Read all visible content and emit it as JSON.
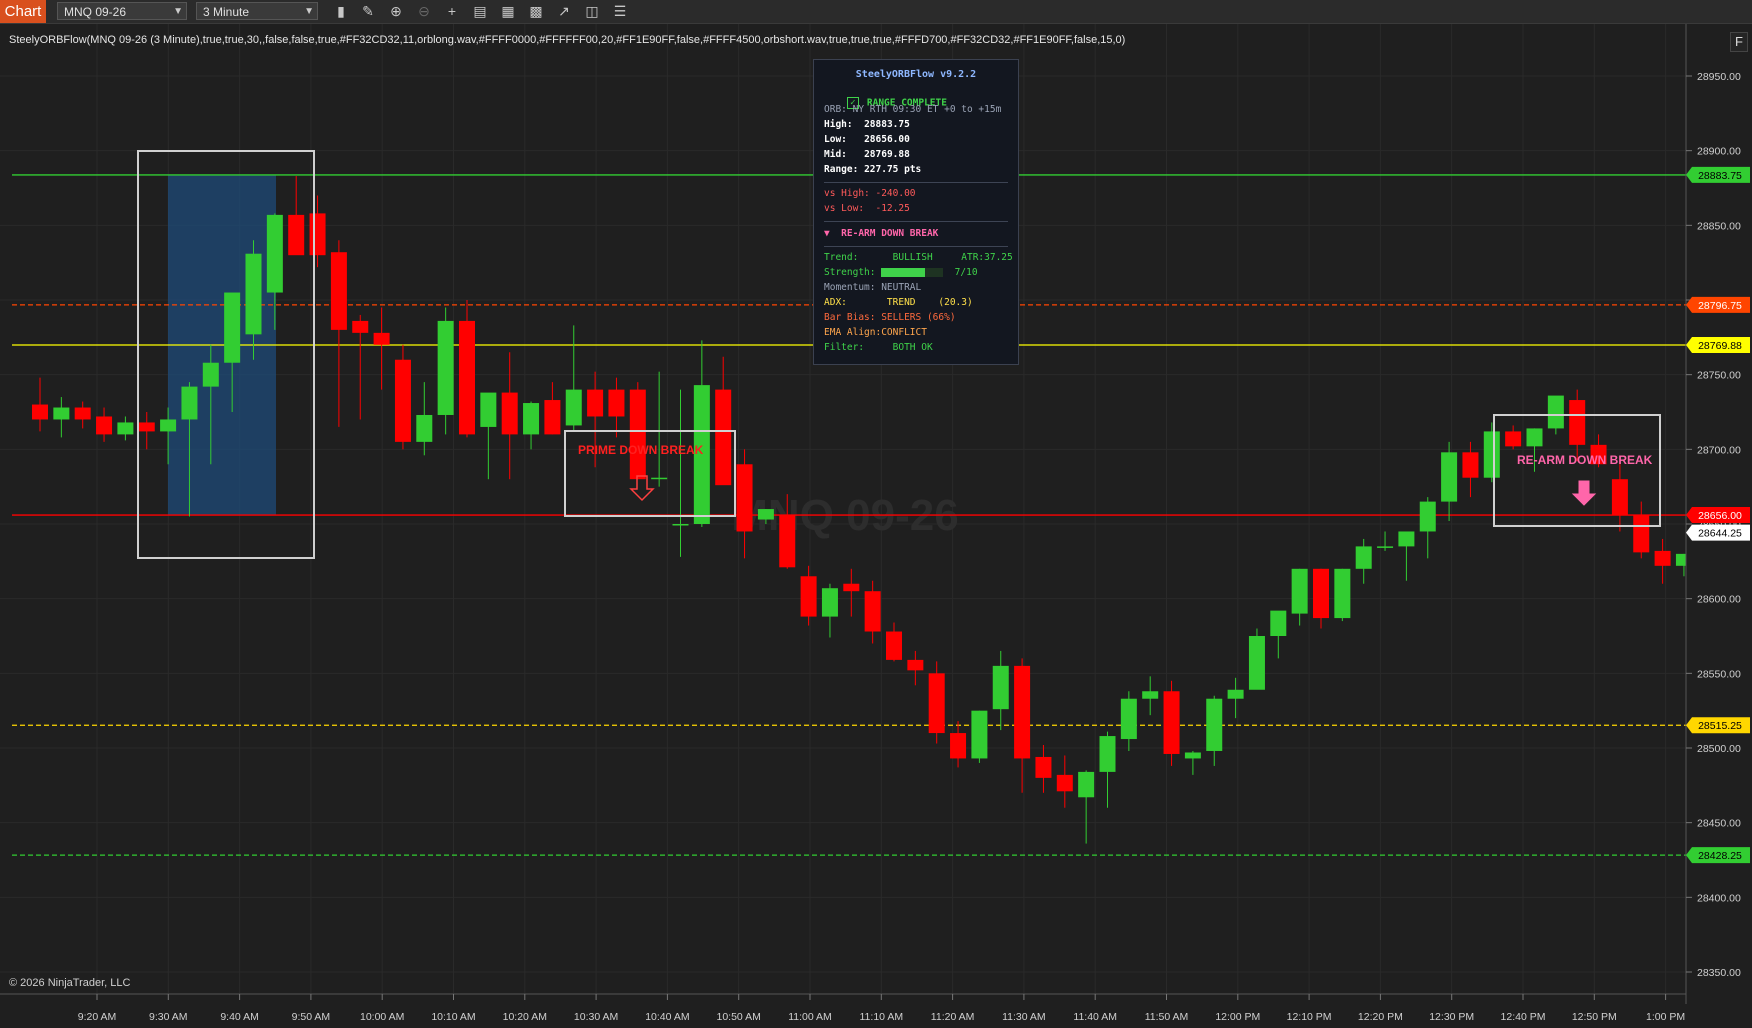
{
  "toolbar": {
    "tab": "Chart",
    "instrument": "MNQ 09-26",
    "interval": "3 Minute",
    "icons": [
      "bar-type-icon",
      "draw-pen-icon",
      "zoom-in-icon",
      "zoom-out-icon",
      "crosshair-icon",
      "properties-icon",
      "templates-icon",
      "strategies-icon",
      "indicators-icon",
      "data-box-icon",
      "list-icon"
    ]
  },
  "indicator_label": "SteelyORBFlow(MNQ 09-26 (3 Minute),true,true,30,,false,false,true,#FF32CD32,11,orblong.wav,#FFFF0000,#FFFFFF00,20,#FF1E90FF,false,#FFFF4500,orbshort.wav,true,true,true,#FFFD700,#FF32CD32,#FF1E90FF,false,15,0)",
  "watermark": "MNQ 09-26",
  "copyright": "© 2026 NinjaTrader, LLC",
  "f_button": "F",
  "panel": {
    "title": "SteelyORBFlow v9.2.2",
    "status": "RANGE COMPLETE",
    "session": "ORB: NY RTH 09:30 ET +0 to +15m",
    "high_label": "High:",
    "high": "28883.75",
    "low_label": "Low:",
    "low": "28656.00",
    "mid_label": "Mid:",
    "mid": "28769.88",
    "range_label": "Range:",
    "range": "227.75 pts",
    "vs_high": "vs High: -240.00",
    "vs_low": "vs Low:  -12.25",
    "signal": "▼  RE-ARM DOWN BREAK",
    "trend": "Trend:      BULLISH     ATR:37.25",
    "strength_label": "Strength:",
    "strength_value": "7/10",
    "strength_fraction": 0.7,
    "momentum": "Momentum: NEUTRAL",
    "adx": "ADX:       TREND    (20.3)",
    "bar_bias": "Bar Bias: SELLERS (66%)",
    "ema_align": "EMA Align:CONFLICT",
    "filter": "Filter:     BOTH OK"
  },
  "price_levels": [
    {
      "label": "28883.75",
      "price": 28883.75,
      "color": "#32cd32",
      "style": "solid",
      "text_color": "#000000"
    },
    {
      "label": "28796.75",
      "price": 28796.75,
      "color": "#ff4500",
      "style": "dashed",
      "text_color": "#ffffff"
    },
    {
      "label": "28769.88",
      "price": 28769.88,
      "color": "#ffff00",
      "style": "solid",
      "text_color": "#000000"
    },
    {
      "label": "28656.00",
      "price": 28656.0,
      "color": "#ff0000",
      "style": "solid",
      "text_color": "#ffffff"
    },
    {
      "label": "28515.25",
      "price": 28515.25,
      "color": "#ffd700",
      "style": "dashed",
      "text_color": "#000000"
    },
    {
      "label": "28428.25",
      "price": 28428.25,
      "color": "#32cd32",
      "style": "dashed",
      "text_color": "#000000"
    }
  ],
  "last_price": "28644.25",
  "signals": [
    {
      "text": "PRIME DOWN BREAK",
      "color": "#ff2020"
    },
    {
      "text": "RE-ARM DOWN BREAK",
      "color": "#ff66aa"
    }
  ],
  "chart_data": {
    "type": "candlestick",
    "y_ticks": [
      "28950.00",
      "28900.00",
      "28850.00",
      "28800.00",
      "28750.00",
      "28700.00",
      "28650.00",
      "28600.00",
      "28550.00",
      "28500.00",
      "28450.00",
      "28400.00",
      "28350.00"
    ],
    "ylim": [
      28330,
      28980
    ],
    "x_ticks": [
      "9:20 AM",
      "9:30 AM",
      "9:40 AM",
      "9:50 AM",
      "10:00 AM",
      "10:10 AM",
      "10:20 AM",
      "10:30 AM",
      "10:40 AM",
      "10:50 AM",
      "11:00 AM",
      "11:10 AM",
      "11:20 AM",
      "11:30 AM",
      "11:40 AM",
      "11:50 AM",
      "12:00 PM",
      "12:10 PM",
      "12:20 PM",
      "12:30 PM",
      "12:40 PM",
      "12:50 PM",
      "1:00 PM"
    ],
    "bull_color": "#32cd32",
    "bear_color": "#ff0000",
    "candles": [
      [
        28730,
        28748,
        28712,
        28720
      ],
      [
        28720,
        28735,
        28708,
        28728
      ],
      [
        28728,
        28732,
        28714,
        28720
      ],
      [
        28722,
        28728,
        28705,
        28710
      ],
      [
        28710,
        28722,
        28706,
        28718
      ],
      [
        28718,
        28725,
        28700,
        28712
      ],
      [
        28712,
        28728,
        28690,
        28720
      ],
      [
        28720,
        28745,
        28655,
        28742
      ],
      [
        28742,
        28770,
        28690,
        28758
      ],
      [
        28758,
        28800,
        28725,
        28805
      ],
      [
        28777,
        28840,
        28760,
        28831
      ],
      [
        28805,
        28858,
        28780,
        28857
      ],
      [
        28857,
        28883,
        28840,
        28830
      ],
      [
        28858,
        28870,
        28822,
        28830
      ],
      [
        28832,
        28840,
        28715,
        28780
      ],
      [
        28786,
        28790,
        28720,
        28778
      ],
      [
        28778,
        28795,
        28740,
        28770
      ],
      [
        28760,
        28770,
        28700,
        28705
      ],
      [
        28705,
        28745,
        28696,
        28723
      ],
      [
        28723,
        28795,
        28710,
        28786
      ],
      [
        28786,
        28800,
        28708,
        28710
      ],
      [
        28715,
        28735,
        28680,
        28738
      ],
      [
        28738,
        28765,
        28680,
        28710
      ],
      [
        28710,
        28732,
        28700,
        28731
      ],
      [
        28733,
        28745,
        28710,
        28710
      ],
      [
        28716,
        28783,
        28712,
        28740
      ],
      [
        28740,
        28752,
        28688,
        28722
      ],
      [
        28740,
        28748,
        28708,
        28722
      ],
      [
        28740,
        28745,
        28680,
        28680
      ],
      [
        28681,
        28752,
        28675,
        28681
      ],
      [
        28650,
        28740,
        28628,
        28650
      ],
      [
        28650,
        28773,
        28648,
        28743
      ],
      [
        28740,
        28762,
        28680,
        28676
      ],
      [
        28690,
        28700,
        28627,
        28645
      ],
      [
        28653,
        28660,
        28650,
        28660
      ],
      [
        28656,
        28670,
        28620,
        28621
      ],
      [
        28615,
        28622,
        28582,
        28588
      ],
      [
        28588,
        28610,
        28574,
        28607
      ],
      [
        28610,
        28620,
        28588,
        28605
      ],
      [
        28605,
        28612,
        28570,
        28578
      ],
      [
        28578,
        28584,
        28558,
        28559
      ],
      [
        28559,
        28565,
        28542,
        28552
      ],
      [
        28550,
        28558,
        28503,
        28510
      ],
      [
        28510,
        28518,
        28487,
        28493
      ],
      [
        28493,
        28525,
        28490,
        28525
      ],
      [
        28526,
        28565,
        28512,
        28555
      ],
      [
        28555,
        28560,
        28470,
        28493
      ],
      [
        28494,
        28502,
        28470,
        28480
      ],
      [
        28482,
        28495,
        28460,
        28471
      ],
      [
        28467,
        28485,
        28436,
        28484
      ],
      [
        28484,
        28511,
        28460,
        28508
      ],
      [
        28506,
        28538,
        28498,
        28533
      ],
      [
        28533,
        28548,
        28522,
        28538
      ],
      [
        28538,
        28545,
        28488,
        28496
      ],
      [
        28493,
        28498,
        28482,
        28497
      ],
      [
        28498,
        28535,
        28488,
        28533
      ],
      [
        28533,
        28547,
        28520,
        28539
      ],
      [
        28539,
        28580,
        28540,
        28575
      ],
      [
        28575,
        28590,
        28560,
        28592
      ],
      [
        28590,
        28620,
        28582,
        28620
      ],
      [
        28620,
        28620,
        28580,
        28587
      ],
      [
        28587,
        28620,
        28585,
        28620
      ],
      [
        28620,
        28640,
        28610,
        28635
      ],
      [
        28634,
        28645,
        28632,
        28635
      ],
      [
        28635,
        28640,
        28612,
        28645
      ],
      [
        28645,
        28668,
        28627,
        28665
      ],
      [
        28665,
        28705,
        28652,
        28698
      ],
      [
        28698,
        28705,
        28668,
        28681
      ],
      [
        28681,
        28718,
        28678,
        28712
      ],
      [
        28712,
        28716,
        28700,
        28702
      ],
      [
        28702,
        28714,
        28685,
        28714
      ],
      [
        28714,
        28735,
        28710,
        28736
      ],
      [
        28733,
        28740,
        28692,
        28703
      ],
      [
        28703,
        28710,
        28688,
        28690
      ],
      [
        28680,
        28692,
        28645,
        28656
      ],
      [
        28656,
        28665,
        28627,
        28631
      ],
      [
        28632,
        28640,
        28610,
        28622
      ],
      [
        28622,
        28630,
        28615,
        28630
      ],
      [
        28630,
        28648,
        28625,
        28650
      ]
    ]
  }
}
